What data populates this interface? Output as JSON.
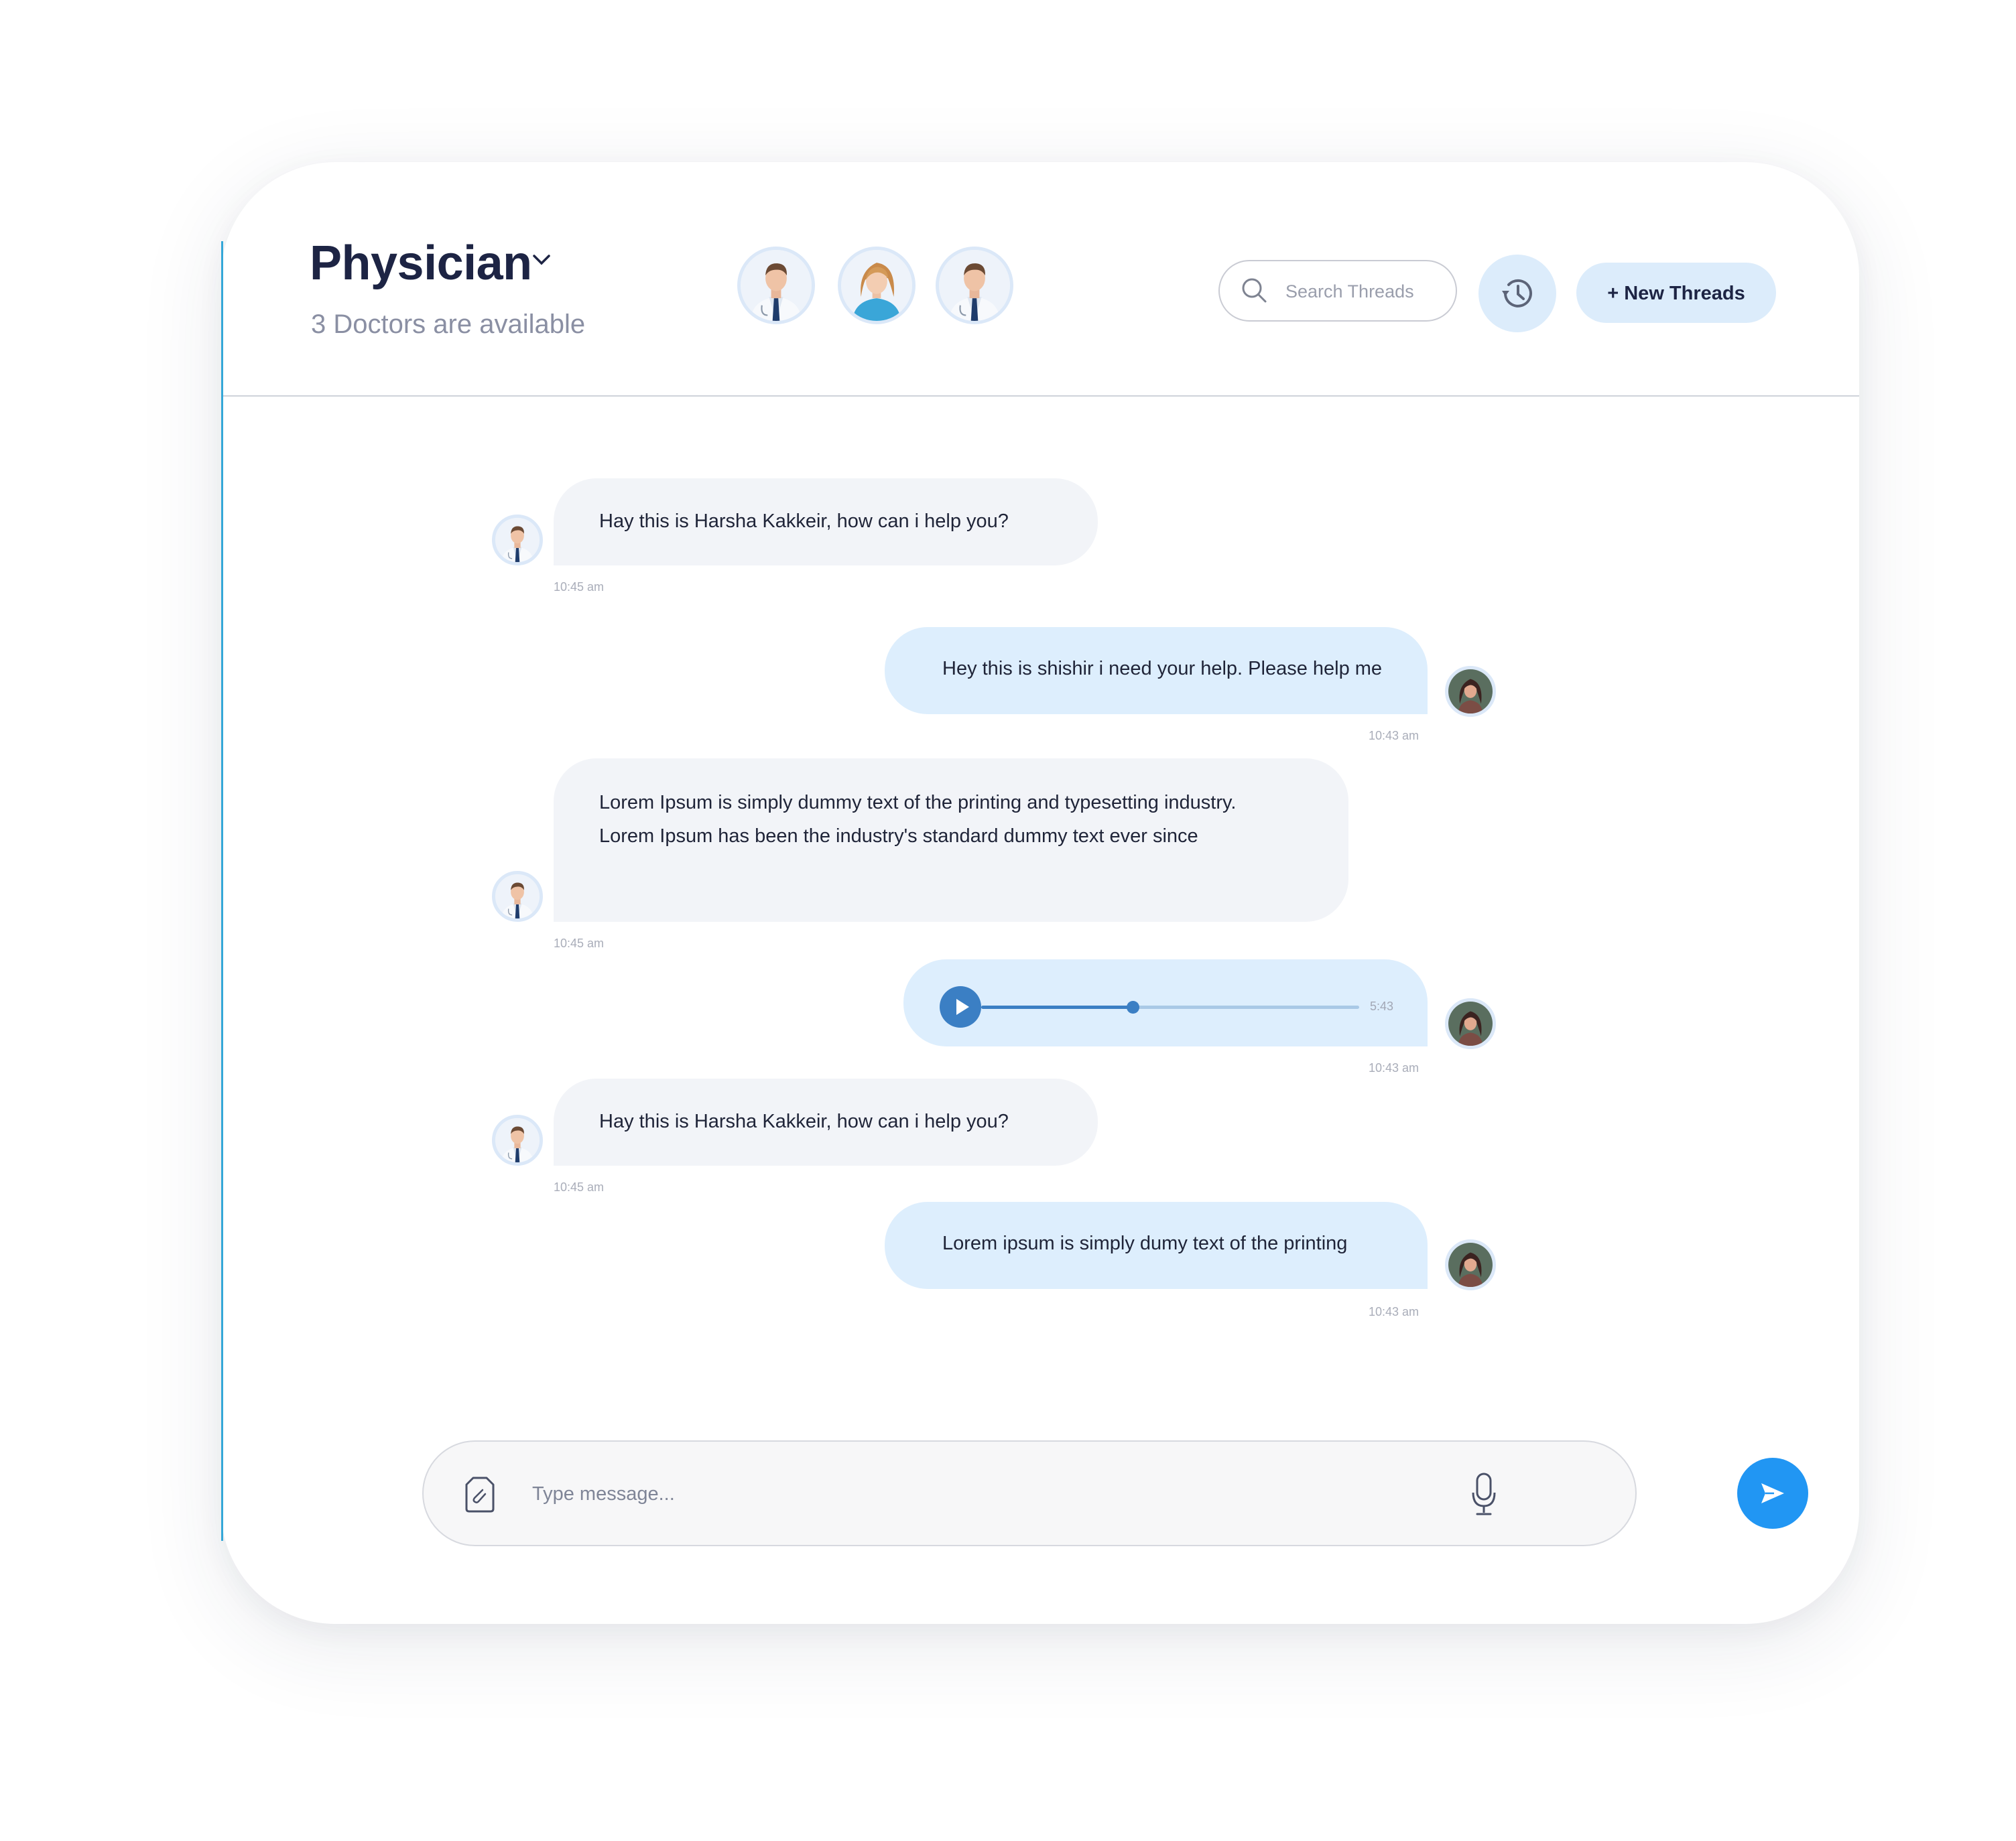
{
  "header": {
    "title": "Physician",
    "subtitle": "3 Doctors are available",
    "doctors": [
      {
        "name": "doctor-avatar-1",
        "icon": "male-doctor-avatar"
      },
      {
        "name": "doctor-avatar-2",
        "icon": "female-doctor-avatar"
      },
      {
        "name": "doctor-avatar-3",
        "icon": "male-doctor-avatar"
      }
    ],
    "search": {
      "placeholder": "Search Threads",
      "icon": "search-icon"
    },
    "history": {
      "icon": "history-icon"
    },
    "new_thread_label": "+ New Threads"
  },
  "messages": [
    {
      "direction": "in",
      "text": "Hay this is Harsha Kakkeir, how can i help you?",
      "time": "10:45 am"
    },
    {
      "direction": "out",
      "text": "Hey this is shishir i need your help. Please help me",
      "time": "10:43 am"
    },
    {
      "direction": "in",
      "lines": [
        "Lorem Ipsum is simply dummy text of the printing and typesetting industry.",
        "Lorem Ipsum has been the industry's standard dummy text ever since"
      ],
      "time": "10:45 am"
    },
    {
      "direction": "out",
      "type": "audio",
      "duration": "5:43",
      "progress": 0.4,
      "time": "10:43 am"
    },
    {
      "direction": "in",
      "text": "Hay this is Harsha Kakkeir, how can i help you?",
      "time": "10:45 am"
    },
    {
      "direction": "out",
      "text": "Lorem ipsum is simply dumy text of the printing",
      "time": "10:43 am"
    }
  ],
  "composer": {
    "placeholder": "Type message...",
    "attach_icon": "attachment-file-icon",
    "mic_icon": "microphone-icon",
    "send_icon": "send-icon"
  },
  "colors": {
    "title": "#1d2444",
    "incoming_bubble": "#f2f4f8",
    "outgoing_bubble": "#ddeefd",
    "send_button": "#2196f3",
    "audio_accent": "#3b7fc4",
    "accent_line": "#34a7d8"
  }
}
